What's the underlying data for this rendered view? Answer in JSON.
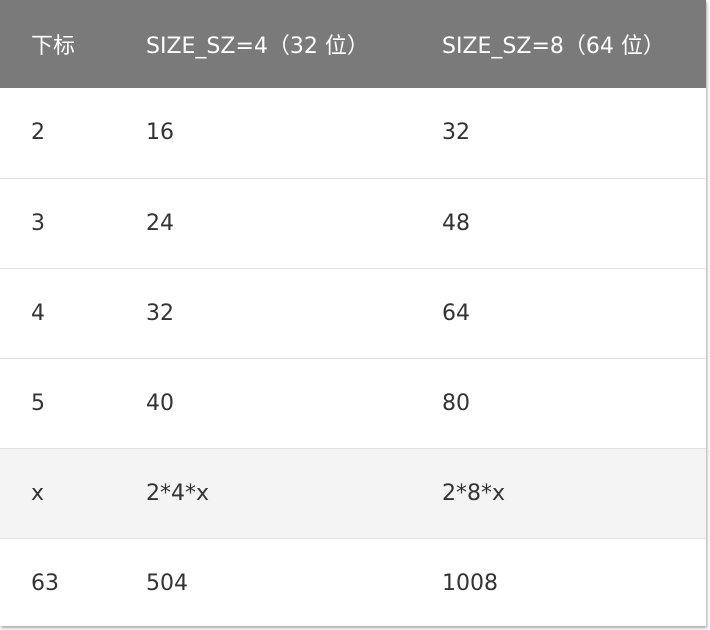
{
  "table": {
    "headers": [
      "下标",
      "SIZE_SZ=4（32 位）",
      "SIZE_SZ=8（64 位）"
    ],
    "rows": [
      {
        "index": "2",
        "size32": "16",
        "size64": "32"
      },
      {
        "index": "3",
        "size32": "24",
        "size64": "48"
      },
      {
        "index": "4",
        "size32": "32",
        "size64": "64"
      },
      {
        "index": "5",
        "size32": "40",
        "size64": "80"
      },
      {
        "index": "x",
        "size32": "2*4*x",
        "size64": "2*8*x"
      },
      {
        "index": "63",
        "size32": "504",
        "size64": "1008"
      }
    ]
  }
}
